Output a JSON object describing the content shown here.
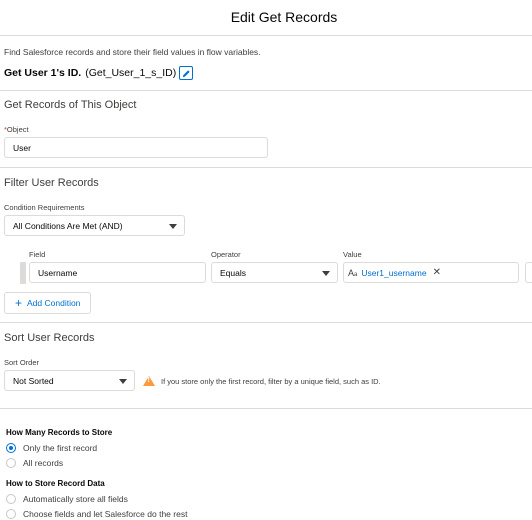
{
  "header": {
    "title": "Edit Get Records"
  },
  "description": "Find Salesforce records and store their field values in flow variables.",
  "element": {
    "label": "Get User 1's ID.",
    "api_name": "(Get_User_1_s_ID)"
  },
  "object_section": {
    "title": "Get Records of This Object",
    "required_mark": "*",
    "object_label": "Object",
    "object_value": "User"
  },
  "filter_section": {
    "title": "Filter User Records",
    "condition_label": "Condition Requirements",
    "condition_value": "All Conditions Are Met (AND)",
    "col_field": "Field",
    "col_operator": "Operator",
    "col_value": "Value",
    "row": {
      "field": "Username",
      "operator": "Equals",
      "value": "User1_username"
    },
    "add_condition": "Add Condition"
  },
  "sort_section": {
    "title": "Sort User Records",
    "sort_label": "Sort Order",
    "sort_value": "Not Sorted",
    "warning": "If you store only the first record, filter by a unique field, such as ID."
  },
  "how_many": {
    "title": "How Many Records to Store",
    "options": [
      {
        "label": "Only the first record",
        "selected": true
      },
      {
        "label": "All records",
        "selected": false
      }
    ]
  },
  "how_store": {
    "title": "How to Store Record Data",
    "options": [
      {
        "label": "Automatically store all fields",
        "selected": false
      },
      {
        "label": "Choose fields and let Salesforce do the rest",
        "selected": false
      }
    ]
  },
  "icons": {
    "edit": "pencil-icon",
    "chevron": "chevron-down-icon",
    "resource": "text-resource-icon",
    "remove": "close-icon",
    "add": "plus-icon",
    "warning": "warning-icon"
  },
  "colors": {
    "brand": "#0070d2",
    "warning": "#ff9a3c",
    "border": "#dddbda"
  }
}
